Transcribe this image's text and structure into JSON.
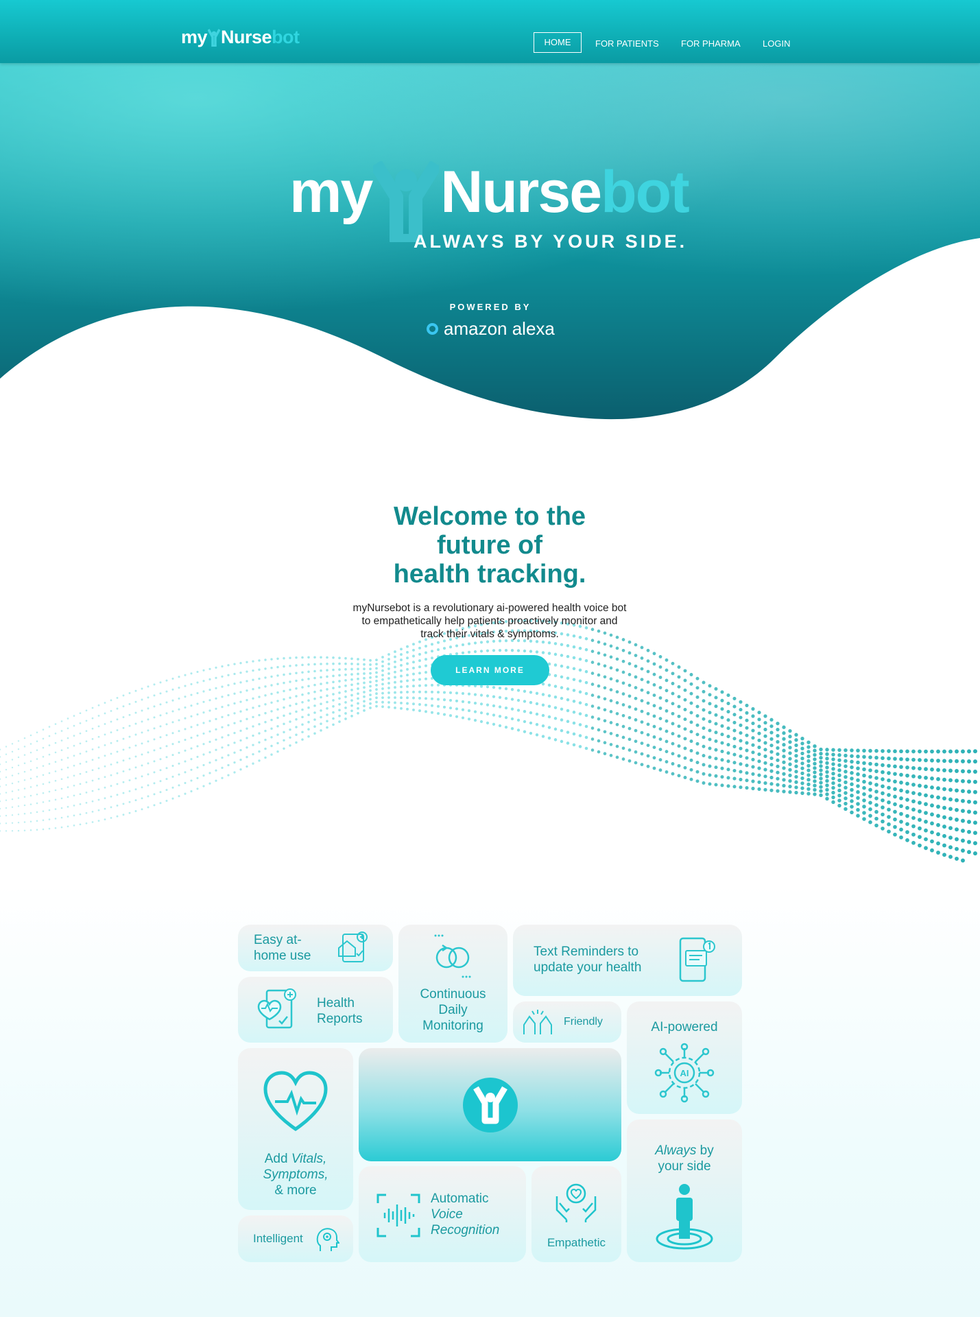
{
  "nav": {
    "logo_my": "my",
    "logo_nurse": "Nurse",
    "logo_bot": "bot",
    "items": [
      {
        "label": "HOME",
        "active": true
      },
      {
        "label": "FOR PATIENTS"
      },
      {
        "label": "FOR PHARMA"
      },
      {
        "label": "LOGIN"
      }
    ]
  },
  "hero": {
    "title_my": "my",
    "title_nurse": "Nurse",
    "title_bot": "bot",
    "tagline": "ALWAYS BY YOUR SIDE.",
    "powered_by": "POWERED BY",
    "alexa": "amazon alexa"
  },
  "welcome": {
    "title_line1": "Welcome to the",
    "title_line2": "future of",
    "title_line3": "health tracking.",
    "text": "myNursebot is a revolutionary ai-powered health voice bot to empathetically help patients proactively monitor and track their vitals & symptoms.",
    "button": "LEARN MORE"
  },
  "features": {
    "easy_1": "Easy at-",
    "easy_2": "home use",
    "continuous_1": "Continuous",
    "continuous_2": "Daily",
    "continuous_3": "Monitoring",
    "reminders_1": "Text Reminders to",
    "reminders_2": "update your health",
    "health_1": "Health",
    "health_2": "Reports",
    "friendly": "Friendly",
    "ai": "AI-powered",
    "vitals_1a": "Add ",
    "vitals_1b": "Vitals,",
    "vitals_2": "Symptoms,",
    "vitals_3": "& more",
    "always_1a": "Always",
    "always_1b": " by",
    "always_2": "your side",
    "voice_1": "Automatic",
    "voice_2": "Voice",
    "voice_3": "Recognition",
    "empathetic": "Empathetic",
    "intelligent": "Intelligent"
  },
  "colors": {
    "brand_teal": "#128a8d",
    "accent_cyan": "#1fcad3",
    "nav_teal": "#0fb0b7"
  }
}
